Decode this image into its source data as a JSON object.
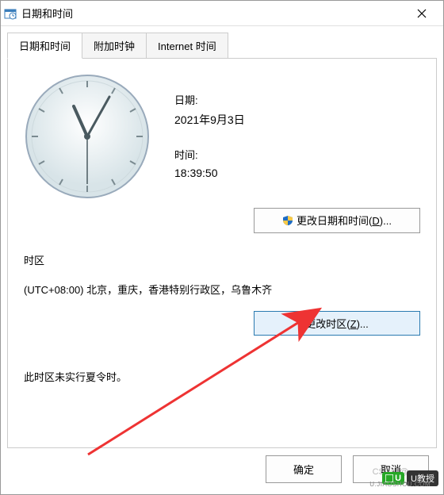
{
  "window": {
    "title": "日期和时间"
  },
  "tabs": {
    "t0": "日期和时间",
    "t1": "附加时钟",
    "t2": "Internet 时间"
  },
  "date": {
    "label": "日期:",
    "value": "2021年9月3日"
  },
  "time": {
    "label": "时间:",
    "value": "18:39:50"
  },
  "buttons": {
    "change_dt_prefix": "更改日期和时间(",
    "change_dt_key": "D",
    "change_dt_suffix": ")...",
    "change_tz_prefix": "更改时区(",
    "change_tz_key": "Z",
    "change_tz_suffix": ")...",
    "ok": "确定",
    "cancel": "取消"
  },
  "timezone": {
    "label": "时区",
    "value": "(UTC+08:00) 北京，重庆，香港特别行政区，乌鲁木齐",
    "dst_note": "此时区未实行夏令时。"
  },
  "watermark": {
    "csdn_prefix": "CSDN @",
    "brand_u": "U",
    "brand_text": "U教授",
    "brand_url": "U.JIAOSHOU.COM"
  }
}
